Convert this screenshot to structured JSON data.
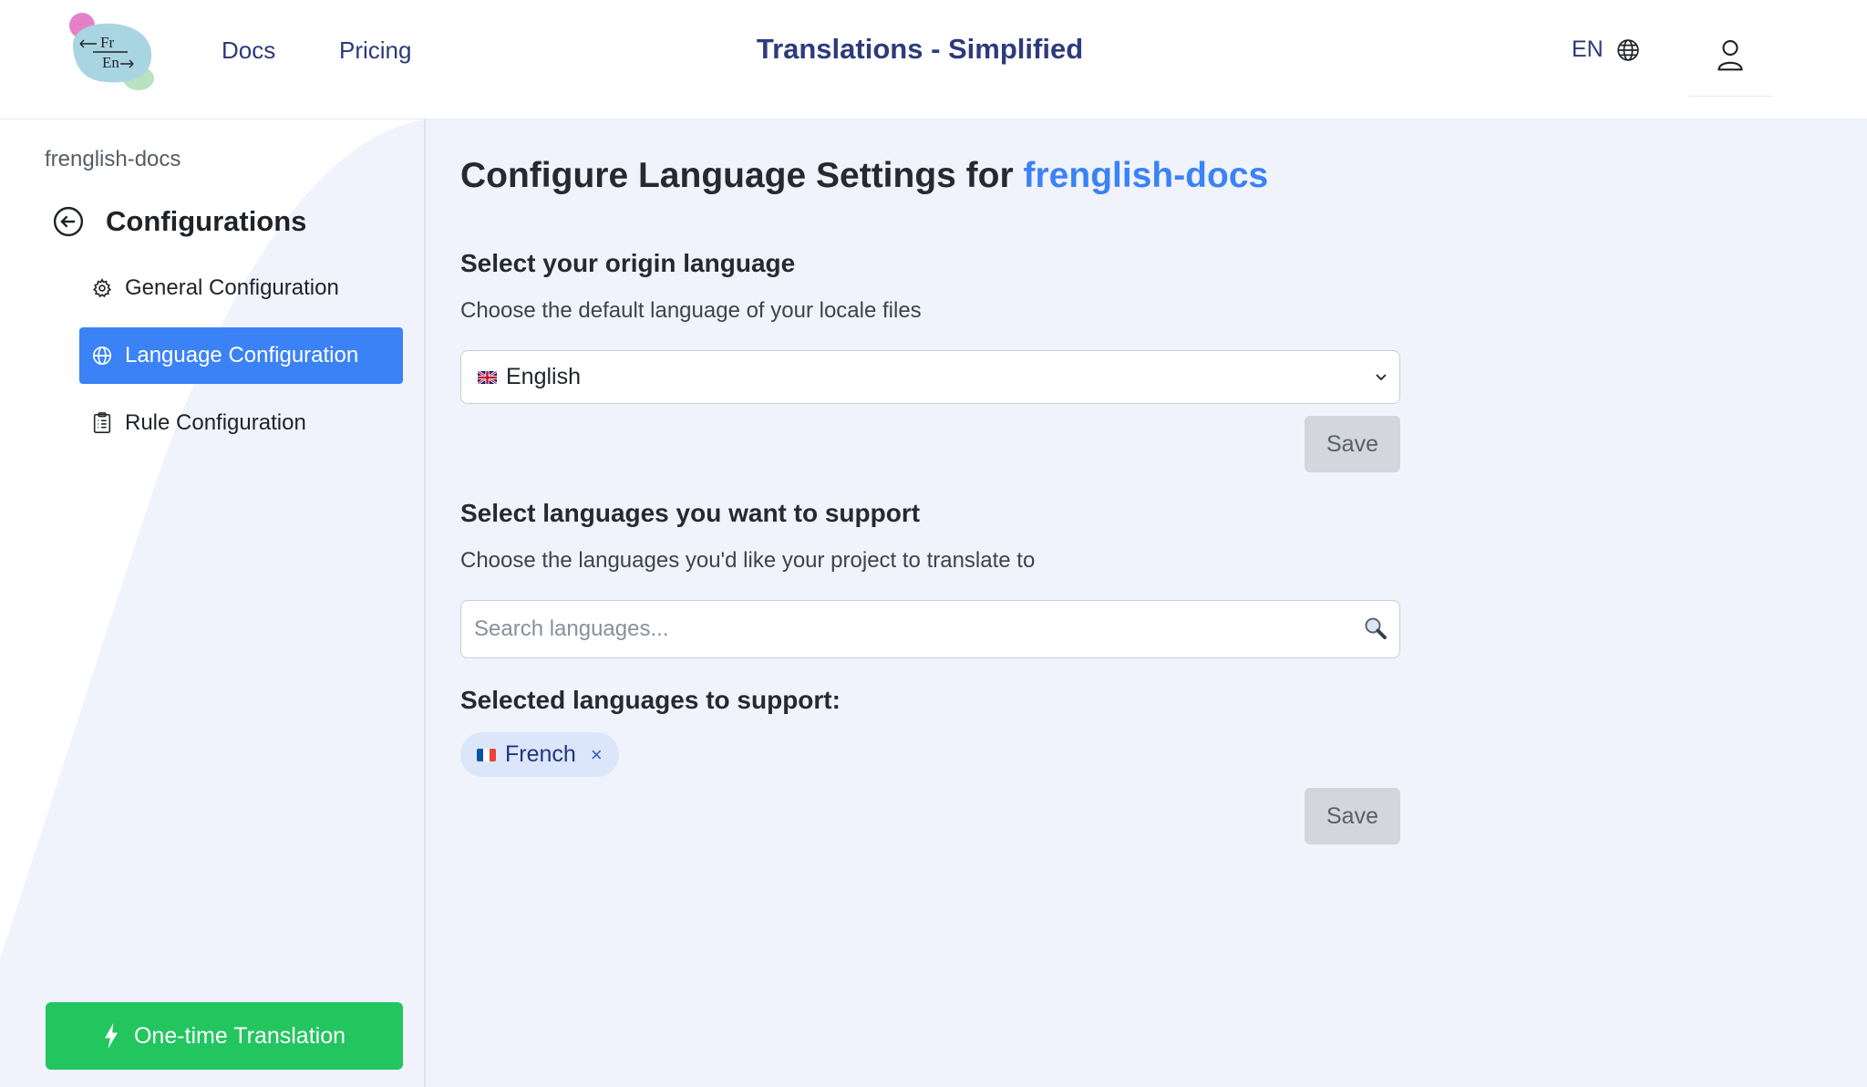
{
  "header": {
    "logo_text_top": "Fr",
    "logo_text_bottom": "En",
    "nav": {
      "docs": "Docs",
      "pricing": "Pricing"
    },
    "app_title": "Translations - Simplified",
    "language_code": "EN"
  },
  "sidebar": {
    "project_name": "frenglish-docs",
    "section_title": "Configurations",
    "items": [
      {
        "label": "General Configuration",
        "icon": "gear-icon",
        "active": false
      },
      {
        "label": "Language Configuration",
        "icon": "globe-icon",
        "active": true
      },
      {
        "label": "Rule Configuration",
        "icon": "clipboard-list-icon",
        "active": false
      }
    ],
    "one_time_button": "One-time Translation"
  },
  "main": {
    "title_prefix": "Configure Language Settings for",
    "title_project": "frenglish-docs",
    "origin": {
      "title": "Select your origin language",
      "description": "Choose the default language of your locale files",
      "selected_language": "English",
      "save_label": "Save"
    },
    "support": {
      "title": "Select languages you want to support",
      "description": "Choose the languages you'd like your project to translate to",
      "search_placeholder": "Search languages...",
      "selected_title": "Selected languages to support:",
      "selected": [
        {
          "label": "French",
          "remove": "×"
        }
      ],
      "save_label": "Save"
    }
  },
  "colors": {
    "accent_blue": "#3b82f6",
    "success_green": "#22c55e",
    "nav_navy": "#2d3b7c"
  }
}
